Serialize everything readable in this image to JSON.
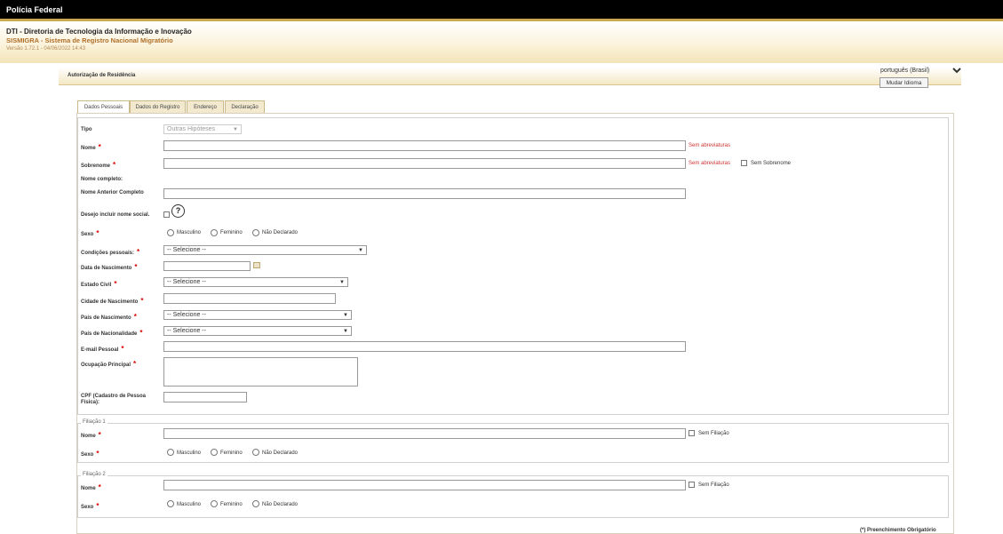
{
  "topbar": {
    "title": "Polícia Federal"
  },
  "header": {
    "org": "DTI - Diretoria de Tecnologia da Informação e Inovação",
    "system": "SISMIGRA - Sistema de Registro Nacional Migratório",
    "version": "Versão 1.72.1 - 04/06/2022 14:43"
  },
  "page": {
    "title": "Autorização de Residência",
    "language_selected": "português (Brasil)",
    "change_language_button": "Mudar Idioma"
  },
  "tabs": [
    {
      "label": "Dados Pessoais",
      "active": true
    },
    {
      "label": "Dados do Registro",
      "active": false
    },
    {
      "label": "Endereço",
      "active": false
    },
    {
      "label": "Declaração",
      "active": false
    }
  ],
  "form": {
    "tipo": {
      "label": "Tipo",
      "value": "Outras Hipóteses"
    },
    "nome": {
      "label": "Nome",
      "hint": "Sem abreviaturas"
    },
    "sobrenome": {
      "label": "Sobrenome",
      "hint": "Sem abreviaturas",
      "checkbox_label": "Sem Sobrenome"
    },
    "nome_completo": {
      "label": "Nome completo:"
    },
    "nome_anterior": {
      "label": "Nome Anterior Completo"
    },
    "nome_social": {
      "label": "Desejo incluir nome social.",
      "help_icon_text": "?"
    },
    "sexo": {
      "label": "Sexo",
      "options": [
        "Masculino",
        "Feminino",
        "Não Declarado"
      ]
    },
    "condicoes": {
      "label": "Condições pessoais:",
      "value": "-- Selecione --"
    },
    "data_nascimento": {
      "label": "Data de Nascimento"
    },
    "estado_civil": {
      "label": "Estado Civil",
      "value": "-- Selecione --"
    },
    "cidade_nascimento": {
      "label": "Cidade de Nascimento"
    },
    "pais_nascimento": {
      "label": "País de Nascimento",
      "value": "-- Selecione --"
    },
    "pais_nacionalidade": {
      "label": "País de Nacionalidade",
      "value": "-- Selecione --"
    },
    "email": {
      "label": "E-mail Pessoal"
    },
    "ocupacao": {
      "label": "Ocupação Principal"
    },
    "cpf": {
      "label": "CPF (Cadastro de Pessoa Física):"
    }
  },
  "filiacao1": {
    "legend": "Filiação 1",
    "nome_label": "Nome",
    "sem_label": "Sem Filiação",
    "sexo_label": "Sexo",
    "options": [
      "Masculino",
      "Feminino",
      "Não Declarado"
    ]
  },
  "filiacao2": {
    "legend": "Filiação 2",
    "nome_label": "Nome",
    "sem_label": "Sem Filiação",
    "sexo_label": "Sexo",
    "options": [
      "Masculino",
      "Feminino",
      "Não Declarado"
    ]
  },
  "footer": {
    "required_note": "(*) Preenchimento Obrigatório"
  },
  "colors": {
    "accent": "#c9a94d",
    "required": "#dd0000",
    "header_text": "#b0702a"
  }
}
